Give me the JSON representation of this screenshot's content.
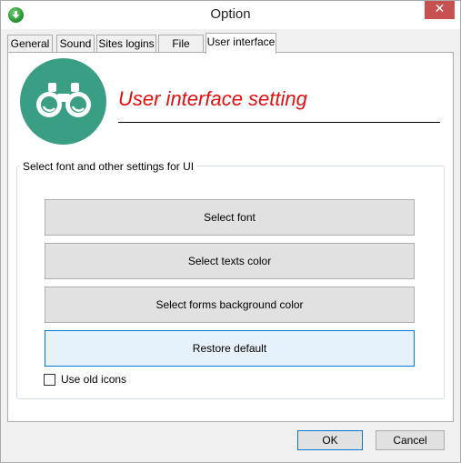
{
  "window": {
    "title": "Option",
    "close_glyph": "✕",
    "app_icon": "download-arrow-icon"
  },
  "tabs": [
    {
      "label": "General",
      "active": false
    },
    {
      "label": "Sound",
      "active": false
    },
    {
      "label": "Sites logins",
      "active": false
    },
    {
      "label": "File types",
      "active": false
    },
    {
      "label": "User interface",
      "active": true
    }
  ],
  "panel": {
    "logo_icon": "binoculars-icon",
    "heading": "User interface setting",
    "group": {
      "legend": "Select font and other settings for UI",
      "buttons": [
        {
          "label": "Select font"
        },
        {
          "label": "Select texts color"
        },
        {
          "label": "Select forms background color"
        },
        {
          "label": "Restore default"
        }
      ],
      "checkbox": {
        "label": "Use old icons",
        "checked": false
      }
    }
  },
  "footer": {
    "ok_label": "OK",
    "cancel_label": "Cancel"
  },
  "colors": {
    "heading": "#e01010",
    "logo_bg": "#3a9e85",
    "close_bg": "#c75050",
    "focus_border": "#0078d7"
  }
}
